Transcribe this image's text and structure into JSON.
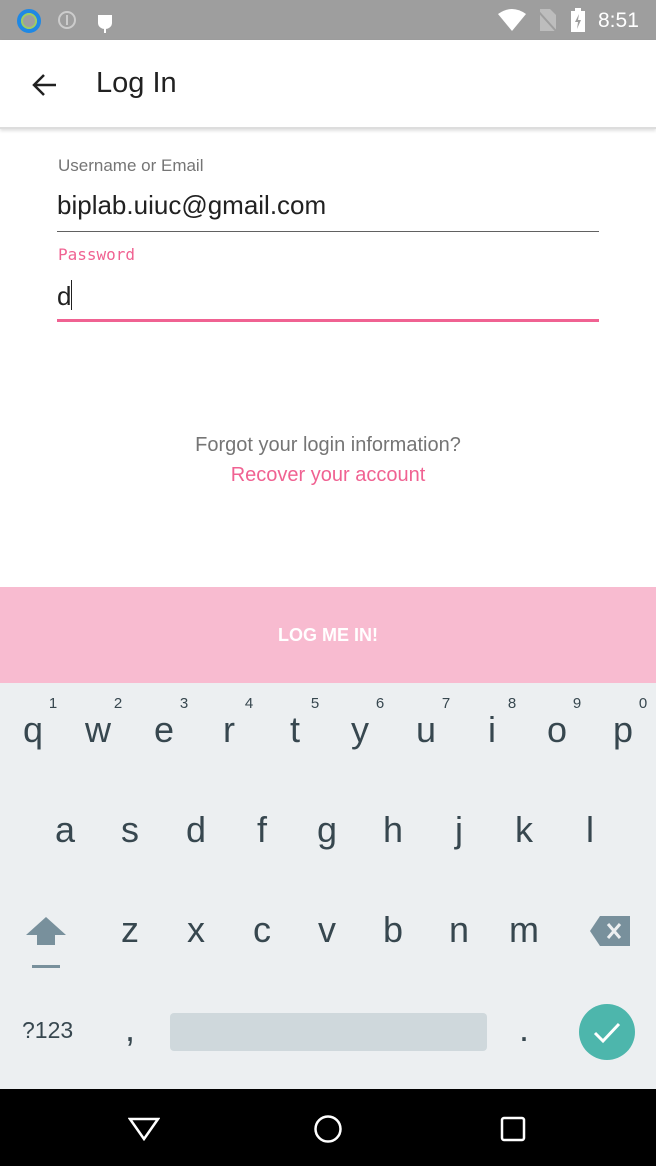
{
  "status_bar": {
    "time": "8:51",
    "icons": [
      "app-ring-icon",
      "sync-icon",
      "android-debug-icon",
      "wifi-icon",
      "no-sim-icon",
      "battery-charging-icon"
    ]
  },
  "app_bar": {
    "title": "Log In",
    "back_icon": "arrow-left-icon"
  },
  "form": {
    "username_label": "Username or Email",
    "username_value": "biplab.uiuc@gmail.com",
    "password_label": "Password",
    "password_value": "d",
    "forgot_text": "Forgot your login information?",
    "recover_link": "Recover your account"
  },
  "login_button": "LOG ME IN!",
  "colors": {
    "accent": "#f06292",
    "button_bg": "#f8bbd0",
    "keyboard_bg": "#eceff1",
    "enter_key": "#4db6ac"
  },
  "keyboard": {
    "row1": [
      "q",
      "w",
      "e",
      "r",
      "t",
      "y",
      "u",
      "i",
      "o",
      "p"
    ],
    "row1_hints": [
      "1",
      "2",
      "3",
      "4",
      "5",
      "6",
      "7",
      "8",
      "9",
      "0"
    ],
    "row2": [
      "a",
      "s",
      "d",
      "f",
      "g",
      "h",
      "j",
      "k",
      "l"
    ],
    "row3": [
      "z",
      "x",
      "c",
      "v",
      "b",
      "n",
      "m"
    ],
    "symbols_key": "?123",
    "comma": ",",
    "period": "."
  }
}
